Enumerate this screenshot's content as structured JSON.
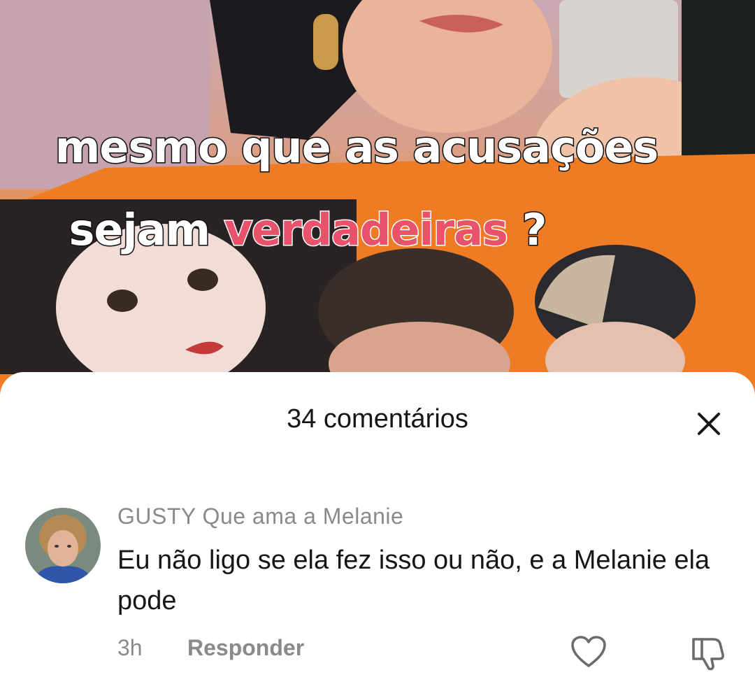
{
  "video": {
    "caption_line1": "mesmo que as acusações",
    "caption_line2_prefix": "sejam",
    "caption_line2_highlight": "verdadeiras",
    "caption_line2_suffix": "?"
  },
  "comments_sheet": {
    "title": "34 comentários",
    "close_icon": "close-icon"
  },
  "comment": {
    "avatar_icon": "user-avatar",
    "username": "GUSTY Que ama a Melanie",
    "text": "Eu não ligo se ela fez isso ou não, e a Melanie ela pode",
    "time": "3h",
    "reply_label": "Responder",
    "like_icon": "heart-icon",
    "dislike_icon": "thumbs-down-icon"
  },
  "colors": {
    "highlight": "#e8526a",
    "muted_text": "#8a8a8a",
    "primary_text": "#161616",
    "backdrop_orange": "#f07a22"
  }
}
